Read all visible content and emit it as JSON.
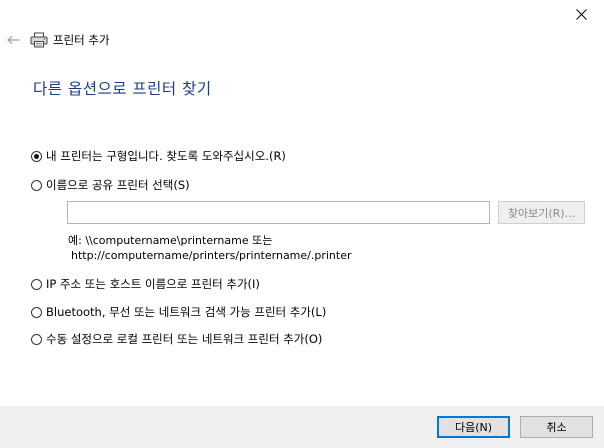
{
  "window": {
    "title": "프린터 추가"
  },
  "page": {
    "heading": "다른 옵션으로 프린터 찾기"
  },
  "options": [
    {
      "label": "내 프린터는 구형입니다. 찾도록 도와주십시오.(R)",
      "selected": true
    },
    {
      "label": "이름으로 공유 프린터 선택(S)",
      "selected": false
    },
    {
      "label": "IP 주소 또는 호스트 이름으로 프린터 추가(I)",
      "selected": false
    },
    {
      "label": "Bluetooth, 무선 또는 네트워크 검색 가능 프린터 추가(L)",
      "selected": false
    },
    {
      "label": "수동 설정으로 로컬 프린터 또는 네트워크 프린터 추가(O)",
      "selected": false
    }
  ],
  "shared": {
    "input_value": "",
    "browse_label": "찾아보기(R)...",
    "example_line1": "예: \\\\computername\\printername 또는",
    "example_line2": "http://computername/printers/printername/.printer"
  },
  "footer": {
    "next_label": "다음(N)",
    "cancel_label": "취소"
  },
  "icons": {
    "close": "close-icon",
    "back": "back-arrow-icon",
    "printer": "printer-icon"
  },
  "colors": {
    "heading": "#1a3c8c",
    "footer_bg": "#f0f0f0",
    "primary_border": "#0078d7"
  }
}
